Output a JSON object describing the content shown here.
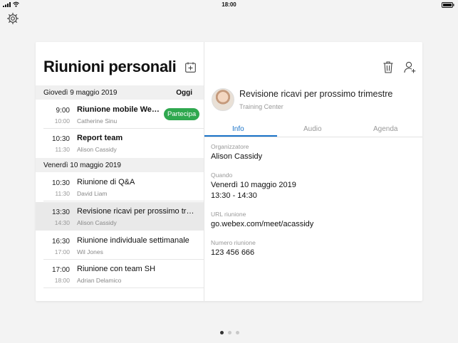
{
  "status_bar": {
    "time": "18:00"
  },
  "left_panel": {
    "title": "Riunioni personali",
    "days": [
      {
        "label": "Giovedì 9 maggio 2019",
        "today_label": "Oggi",
        "meetings": [
          {
            "start": "9:00",
            "end": "10:00",
            "title": "Riunione mobile Webex",
            "host": "Catherine Sinu",
            "join_label": "Partecipa"
          },
          {
            "start": "10:30",
            "end": "11:30",
            "title": "Report team",
            "host": "Alison Cassidy"
          }
        ]
      },
      {
        "label": "Venerdì 10 maggio 2019",
        "meetings": [
          {
            "start": "10:30",
            "end": "11:30",
            "title": "Riunione di Q&A",
            "host": "David Liam"
          },
          {
            "start": "13:30",
            "end": "14:30",
            "title": "Revisione ricavi per prossimo trimestre",
            "host": "Alison Cassidy"
          },
          {
            "start": "16:30",
            "end": "17:00",
            "title": "Riunione individuale settimanale",
            "host": "Wil Jones"
          },
          {
            "start": "17:00",
            "end": "18:00",
            "title": "Riunione con team SH",
            "host": "Adrian Delamico"
          }
        ]
      }
    ]
  },
  "detail": {
    "title": "Revisione ricavi per prossimo trimestre",
    "subtitle": "Training Center",
    "tabs": [
      "Info",
      "Audio",
      "Agenda"
    ],
    "organizer_label": "Organizzatore",
    "organizer": "Alison Cassidy",
    "when_label": "Quando",
    "when_date": "Venerdì 10 maggio 2019",
    "when_time": "13:30 - 14:30",
    "url_label": "URL riunione",
    "url": "go.webex.com/meet/acassidy",
    "number_label": "Numero riunione",
    "number": "123 456 666"
  },
  "colors": {
    "accent": "#1a73c8",
    "join_green": "#2fa84f"
  },
  "icons": [
    "settings-gear-icon",
    "add-calendar-icon",
    "trash-icon",
    "add-person-icon"
  ]
}
